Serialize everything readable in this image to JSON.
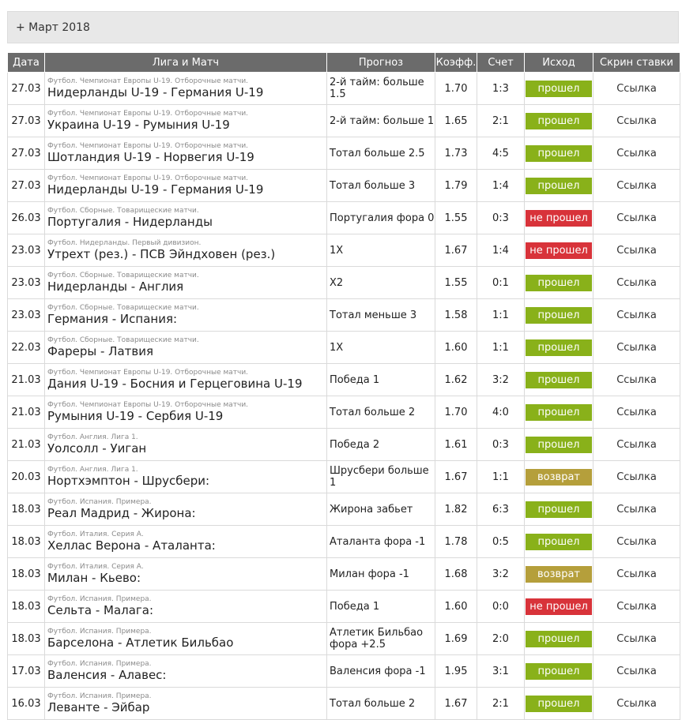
{
  "month": {
    "label": "+ Март 2018"
  },
  "table": {
    "headers": [
      "Дата",
      "Лига и Матч",
      "Прогноз",
      "Коэфф.",
      "Счет",
      "Исход",
      "Скрин ставки"
    ],
    "status_colors": {
      "прошел": "#89b11a",
      "не прошел": "#d8333a",
      "возврат": "#b59f3b"
    },
    "rows": [
      {
        "date": "27.03",
        "league": "Футбол. Чемпионат Европы U-19. Отборочные матчи.",
        "match": "Нидерланды U-19 - Германия U-19",
        "prediction": "2-й тайм: больше 1.5",
        "odds": "1.70",
        "score": "1:3",
        "result": "прошел",
        "status": "win",
        "link": "Ссылка"
      },
      {
        "date": "27.03",
        "league": "Футбол. Чемпионат Европы U-19. Отборочные матчи.",
        "match": "Украина U-19 - Румыния U-19",
        "prediction": "2-й тайм: больше 1",
        "odds": "1.65",
        "score": "2:1",
        "result": "прошел",
        "status": "win",
        "link": "Ссылка"
      },
      {
        "date": "27.03",
        "league": "Футбол. Чемпионат Европы U-19. Отборочные матчи.",
        "match": "Шотландия U-19 - Норвегия U-19",
        "prediction": "Тотал больше 2.5",
        "odds": "1.73",
        "score": "4:5",
        "result": "прошел",
        "status": "win",
        "link": "Ссылка"
      },
      {
        "date": "27.03",
        "league": "Футбол. Чемпионат Европы U-19. Отборочные матчи.",
        "match": "Нидерланды U-19 - Германия U-19",
        "prediction": "Тотал больше 3",
        "odds": "1.79",
        "score": "1:4",
        "result": "прошел",
        "status": "win",
        "link": "Ссылка"
      },
      {
        "date": "26.03",
        "league": "Футбол. Сборные. Товарищеские матчи.",
        "match": "Португалия - Нидерланды",
        "prediction": "Португалия фора 0",
        "odds": "1.55",
        "score": "0:3",
        "result": "не прошел",
        "status": "lose",
        "link": "Ссылка"
      },
      {
        "date": "23.03",
        "league": "Футбол. Нидерланды. Первый дивизион.",
        "match": "Утрехт (рез.) - ПСВ Эйндховен (рез.)",
        "prediction": "1X",
        "odds": "1.67",
        "score": "1:4",
        "result": "не прошел",
        "status": "lose",
        "link": "Ссылка"
      },
      {
        "date": "23.03",
        "league": "Футбол. Сборные. Товарищеские матчи.",
        "match": "Нидерланды - Англия",
        "prediction": "X2",
        "odds": "1.55",
        "score": "0:1",
        "result": "прошел",
        "status": "win",
        "link": "Ссылка"
      },
      {
        "date": "23.03",
        "league": "Футбол. Сборные. Товарищеские матчи.",
        "match": "Германия - Испания:",
        "prediction": "Тотал меньше 3",
        "odds": "1.58",
        "score": "1:1",
        "result": "прошел",
        "status": "win",
        "link": "Ссылка"
      },
      {
        "date": "22.03",
        "league": "Футбол. Сборные. Товарищеские матчи.",
        "match": "Фареры - Латвия",
        "prediction": "1X",
        "odds": "1.60",
        "score": "1:1",
        "result": "прошел",
        "status": "win",
        "link": "Ссылка"
      },
      {
        "date": "21.03",
        "league": "Футбол. Чемпионат Европы U-19. Отборочные матчи.",
        "match": "Дания U-19 - Босния и Герцеговина U-19",
        "prediction": "Победа 1",
        "odds": "1.62",
        "score": "3:2",
        "result": "прошел",
        "status": "win",
        "link": "Ссылка"
      },
      {
        "date": "21.03",
        "league": "Футбол. Чемпионат Европы U-19. Отборочные матчи.",
        "match": "Румыния U-19 - Сербия U-19",
        "prediction": "Тотал больше 2",
        "odds": "1.70",
        "score": "4:0",
        "result": "прошел",
        "status": "win",
        "link": "Ссылка"
      },
      {
        "date": "21.03",
        "league": "Футбол. Англия. Лига 1.",
        "match": "Уолсолл - Уиган",
        "prediction": "Победа 2",
        "odds": "1.61",
        "score": "0:3",
        "result": "прошел",
        "status": "win",
        "link": "Ссылка"
      },
      {
        "date": "20.03",
        "league": "Футбол. Англия. Лига 1.",
        "match": "Нортхэмптон - Шрусбери:",
        "prediction": "Шрусбери больше 1",
        "odds": "1.67",
        "score": "1:1",
        "result": "возврат",
        "status": "refund",
        "link": "Ссылка"
      },
      {
        "date": "18.03",
        "league": "Футбол. Испания. Примера.",
        "match": "Реал Мадрид - Жирона:",
        "prediction": "Жирона забьет",
        "odds": "1.82",
        "score": "6:3",
        "result": "прошел",
        "status": "win",
        "link": "Ссылка"
      },
      {
        "date": "18.03",
        "league": "Футбол. Италия. Серия А.",
        "match": "Хеллас Верона - Аталанта:",
        "prediction": "Аталанта фора -1",
        "odds": "1.78",
        "score": "0:5",
        "result": "прошел",
        "status": "win",
        "link": "Ссылка"
      },
      {
        "date": "18.03",
        "league": "Футбол. Италия. Серия А.",
        "match": "Милан - Кьево:",
        "prediction": "Милан фора -1",
        "odds": "1.68",
        "score": "3:2",
        "result": "возврат",
        "status": "refund",
        "link": "Ссылка"
      },
      {
        "date": "18.03",
        "league": "Футбол. Испания. Примера.",
        "match": "Сельта - Малага:",
        "prediction": "Победа 1",
        "odds": "1.60",
        "score": "0:0",
        "result": "не прошел",
        "status": "lose",
        "link": "Ссылка"
      },
      {
        "date": "18.03",
        "league": "Футбол. Испания. Примера.",
        "match": "Барселона - Атлетик Бильбао",
        "prediction": "Атлетик Бильбао фора +2.5",
        "odds": "1.69",
        "score": "2:0",
        "result": "прошел",
        "status": "win",
        "link": "Ссылка"
      },
      {
        "date": "17.03",
        "league": "Футбол. Испания. Примера.",
        "match": "Валенсия - Алавес:",
        "prediction": "Валенсия фора -1",
        "odds": "1.95",
        "score": "3:1",
        "result": "прошел",
        "status": "win",
        "link": "Ссылка"
      },
      {
        "date": "16.03",
        "league": "Футбол. Испания. Примера.",
        "match": "Леванте - Эйбар",
        "prediction": "Тотал больше 2",
        "odds": "1.67",
        "score": "2:1",
        "result": "прошел",
        "status": "win",
        "link": "Ссылка"
      }
    ]
  }
}
